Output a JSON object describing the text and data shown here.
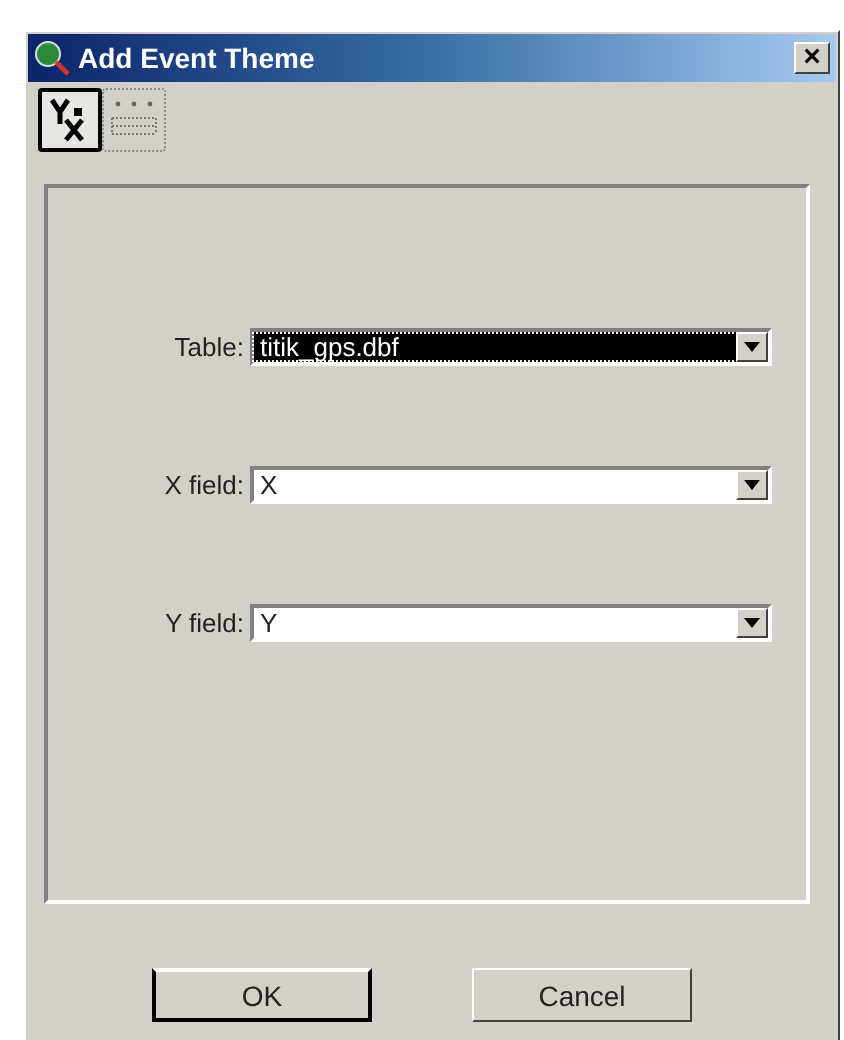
{
  "window": {
    "title": "Add Event Theme",
    "close": "×"
  },
  "tools": [
    {
      "kind": "xy",
      "selected": true
    },
    {
      "kind": "grid",
      "selected": false
    }
  ],
  "fields": [
    {
      "label": "Table:",
      "value": "titik_gps.dbf",
      "focused": true
    },
    {
      "label": "X field:",
      "value": "X",
      "focused": false
    },
    {
      "label": "Y field:",
      "value": "Y",
      "focused": false
    }
  ],
  "buttons": [
    {
      "label": "OK",
      "default": true
    },
    {
      "label": "Cancel",
      "default": false
    }
  ]
}
